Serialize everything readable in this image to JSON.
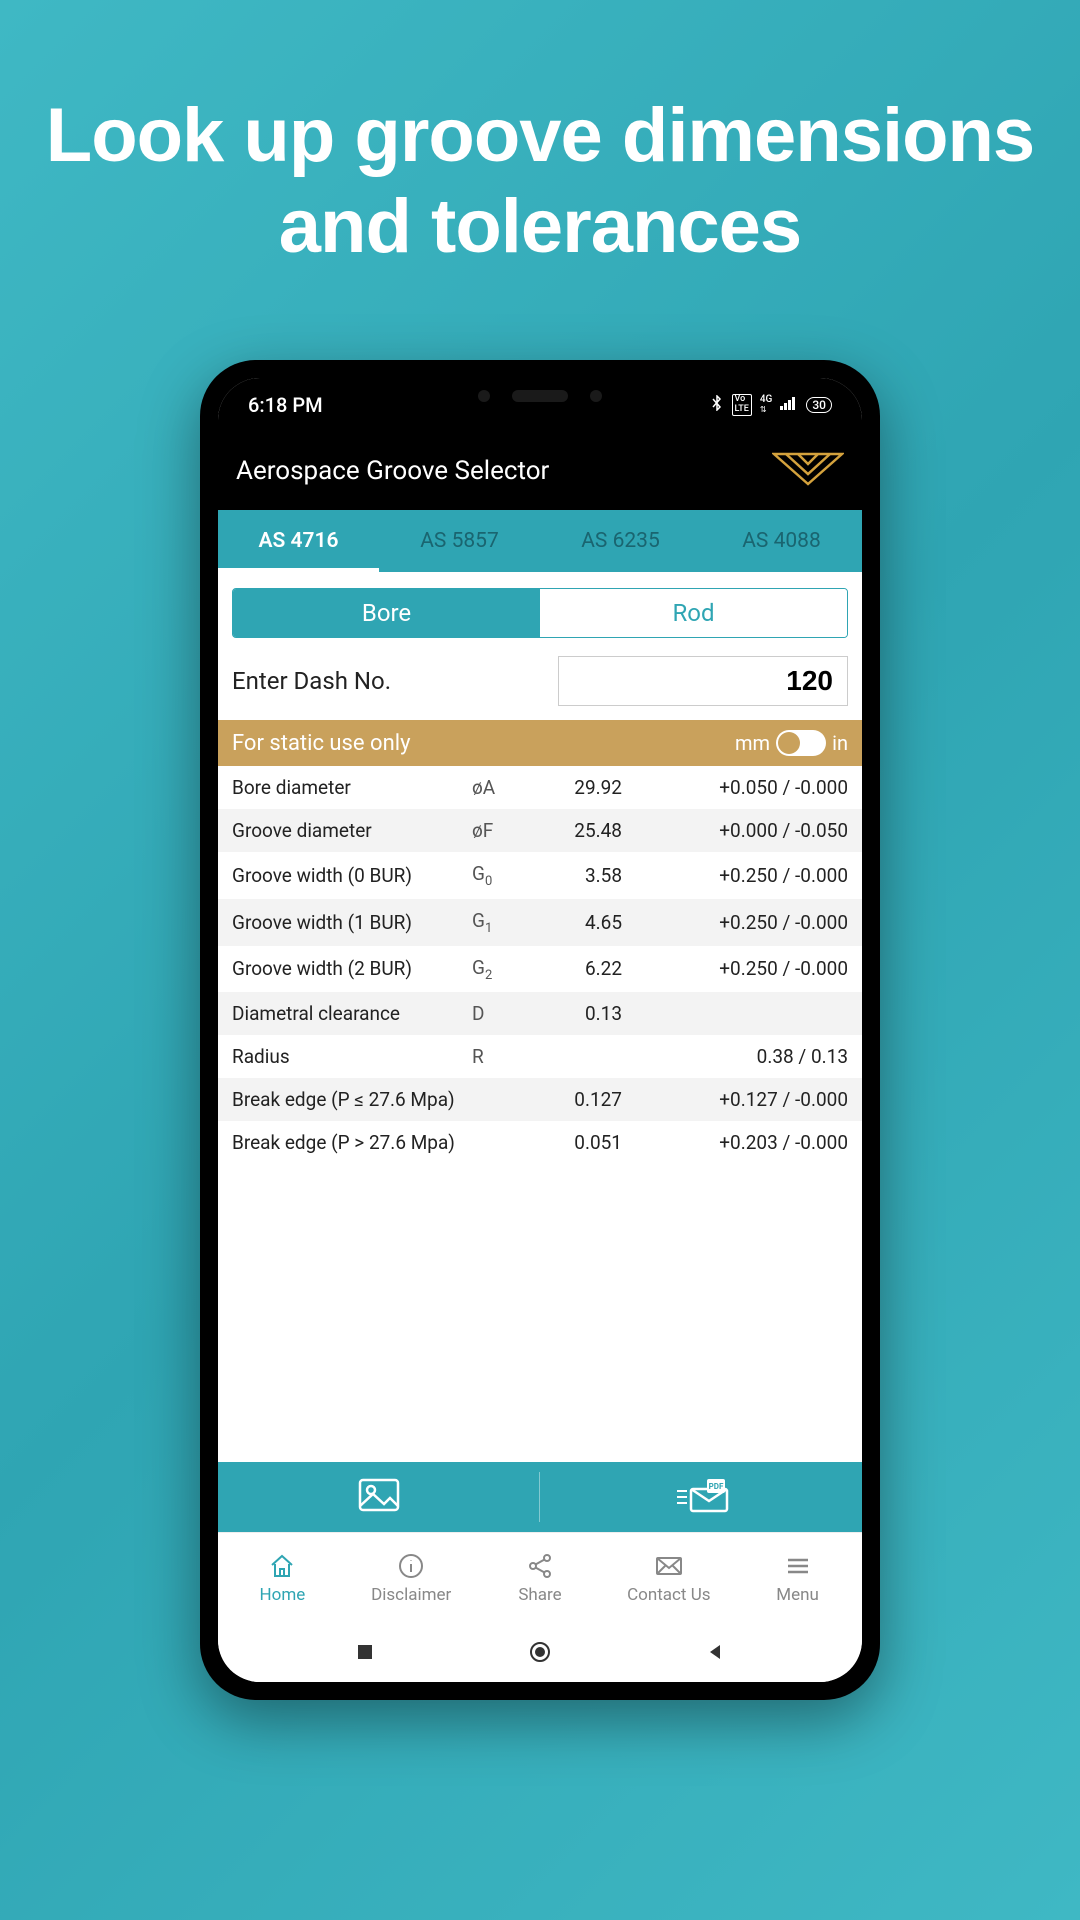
{
  "promo": {
    "headline": "Look up groove dimensions and tolerances"
  },
  "status": {
    "time": "6:18 PM",
    "battery": "30"
  },
  "header": {
    "title": "Aerospace Groove Selector"
  },
  "tabs": [
    "AS 4716",
    "AS 5857",
    "AS 6235",
    "AS 4088"
  ],
  "active_tab": 0,
  "segmented": {
    "bore": "Bore",
    "rod": "Rod",
    "active": "bore"
  },
  "input": {
    "label": "Enter Dash No.",
    "value": "120"
  },
  "static_bar": {
    "note": "For static use only",
    "unit_mm": "mm",
    "unit_in": "in",
    "selected_unit": "mm"
  },
  "rows": [
    {
      "label": "Bore diameter",
      "sym": "øA",
      "sub": "",
      "val": "29.92",
      "tol": "+0.050 / -0.000"
    },
    {
      "label": "Groove diameter",
      "sym": "øF",
      "sub": "",
      "val": "25.48",
      "tol": "+0.000 / -0.050"
    },
    {
      "label": "Groove width (0 BUR)",
      "sym": "G",
      "sub": "0",
      "val": "3.58",
      "tol": "+0.250 / -0.000"
    },
    {
      "label": "Groove width (1 BUR)",
      "sym": "G",
      "sub": "1",
      "val": "4.65",
      "tol": "+0.250 / -0.000"
    },
    {
      "label": "Groove width (2 BUR)",
      "sym": "G",
      "sub": "2",
      "val": "6.22",
      "tol": "+0.250 / -0.000"
    },
    {
      "label": "Diametral clearance",
      "sym": "D",
      "sub": "",
      "val": "0.13",
      "tol": ""
    },
    {
      "label": "Radius",
      "sym": "R",
      "sub": "",
      "val": "",
      "tol": "0.38 / 0.13"
    },
    {
      "label": "Break edge (P ≤ 27.6 Mpa)",
      "sym": "",
      "sub": "",
      "val": "0.127",
      "tol": "+0.127 / -0.000"
    },
    {
      "label": "Break edge (P > 27.6 Mpa)",
      "sym": "",
      "sub": "",
      "val": "0.051",
      "tol": "+0.203 / -0.000"
    }
  ],
  "bottom_nav": {
    "home": "Home",
    "disclaimer": "Disclaimer",
    "share": "Share",
    "contact": "Contact Us",
    "menu": "Menu"
  }
}
